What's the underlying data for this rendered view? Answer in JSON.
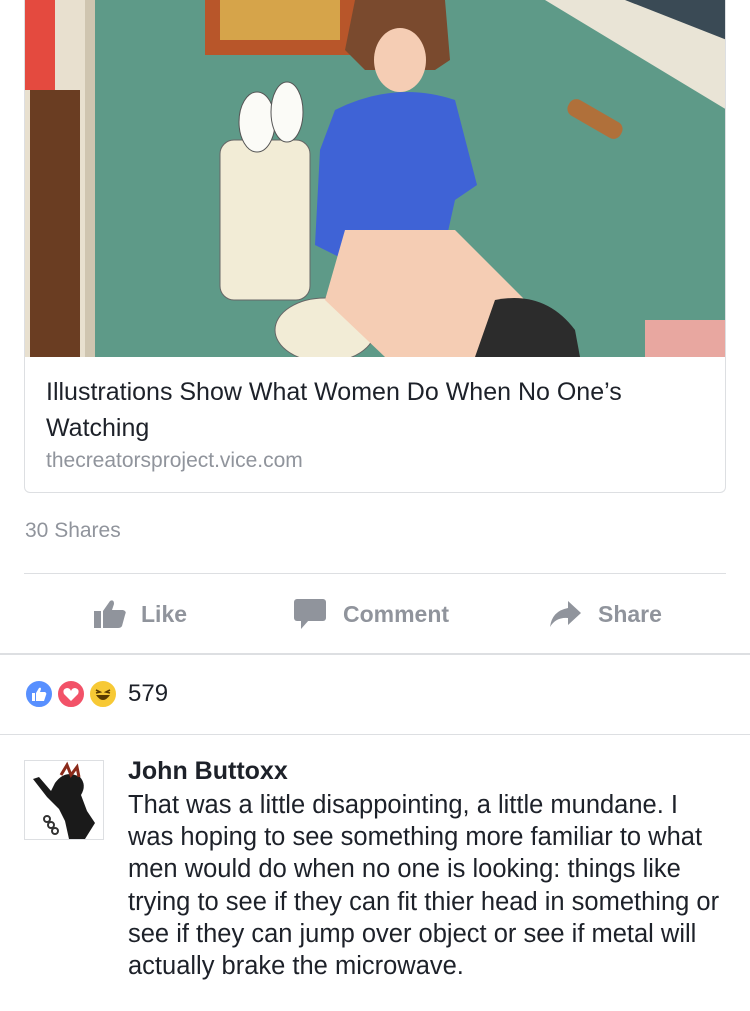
{
  "link_preview": {
    "title": "Illustrations Show What Women Do When No One’s Watching",
    "domain": "thecreatorsproject.vice.com"
  },
  "post_stats": {
    "shares": "30 Shares"
  },
  "actions": {
    "like_label": "Like",
    "comment_label": "Comment",
    "share_label": "Share"
  },
  "reactions": {
    "types": [
      "like",
      "love",
      "haha"
    ],
    "count": "579"
  },
  "comment": {
    "author": "John Buttoxx",
    "text": "That was a little disappointing, a little mundane. I was hoping to see something more familiar to what men would do when no one is looking: things like trying to see if they can fit thier head in something or see if they can jump over object or see if metal will actually brake the microwave."
  },
  "colors": {
    "accent_gray": "#90949c",
    "text": "#1d2129",
    "like_blue": "#5890ff",
    "love_red": "#f25268",
    "haha_yellow": "#f7c935"
  }
}
